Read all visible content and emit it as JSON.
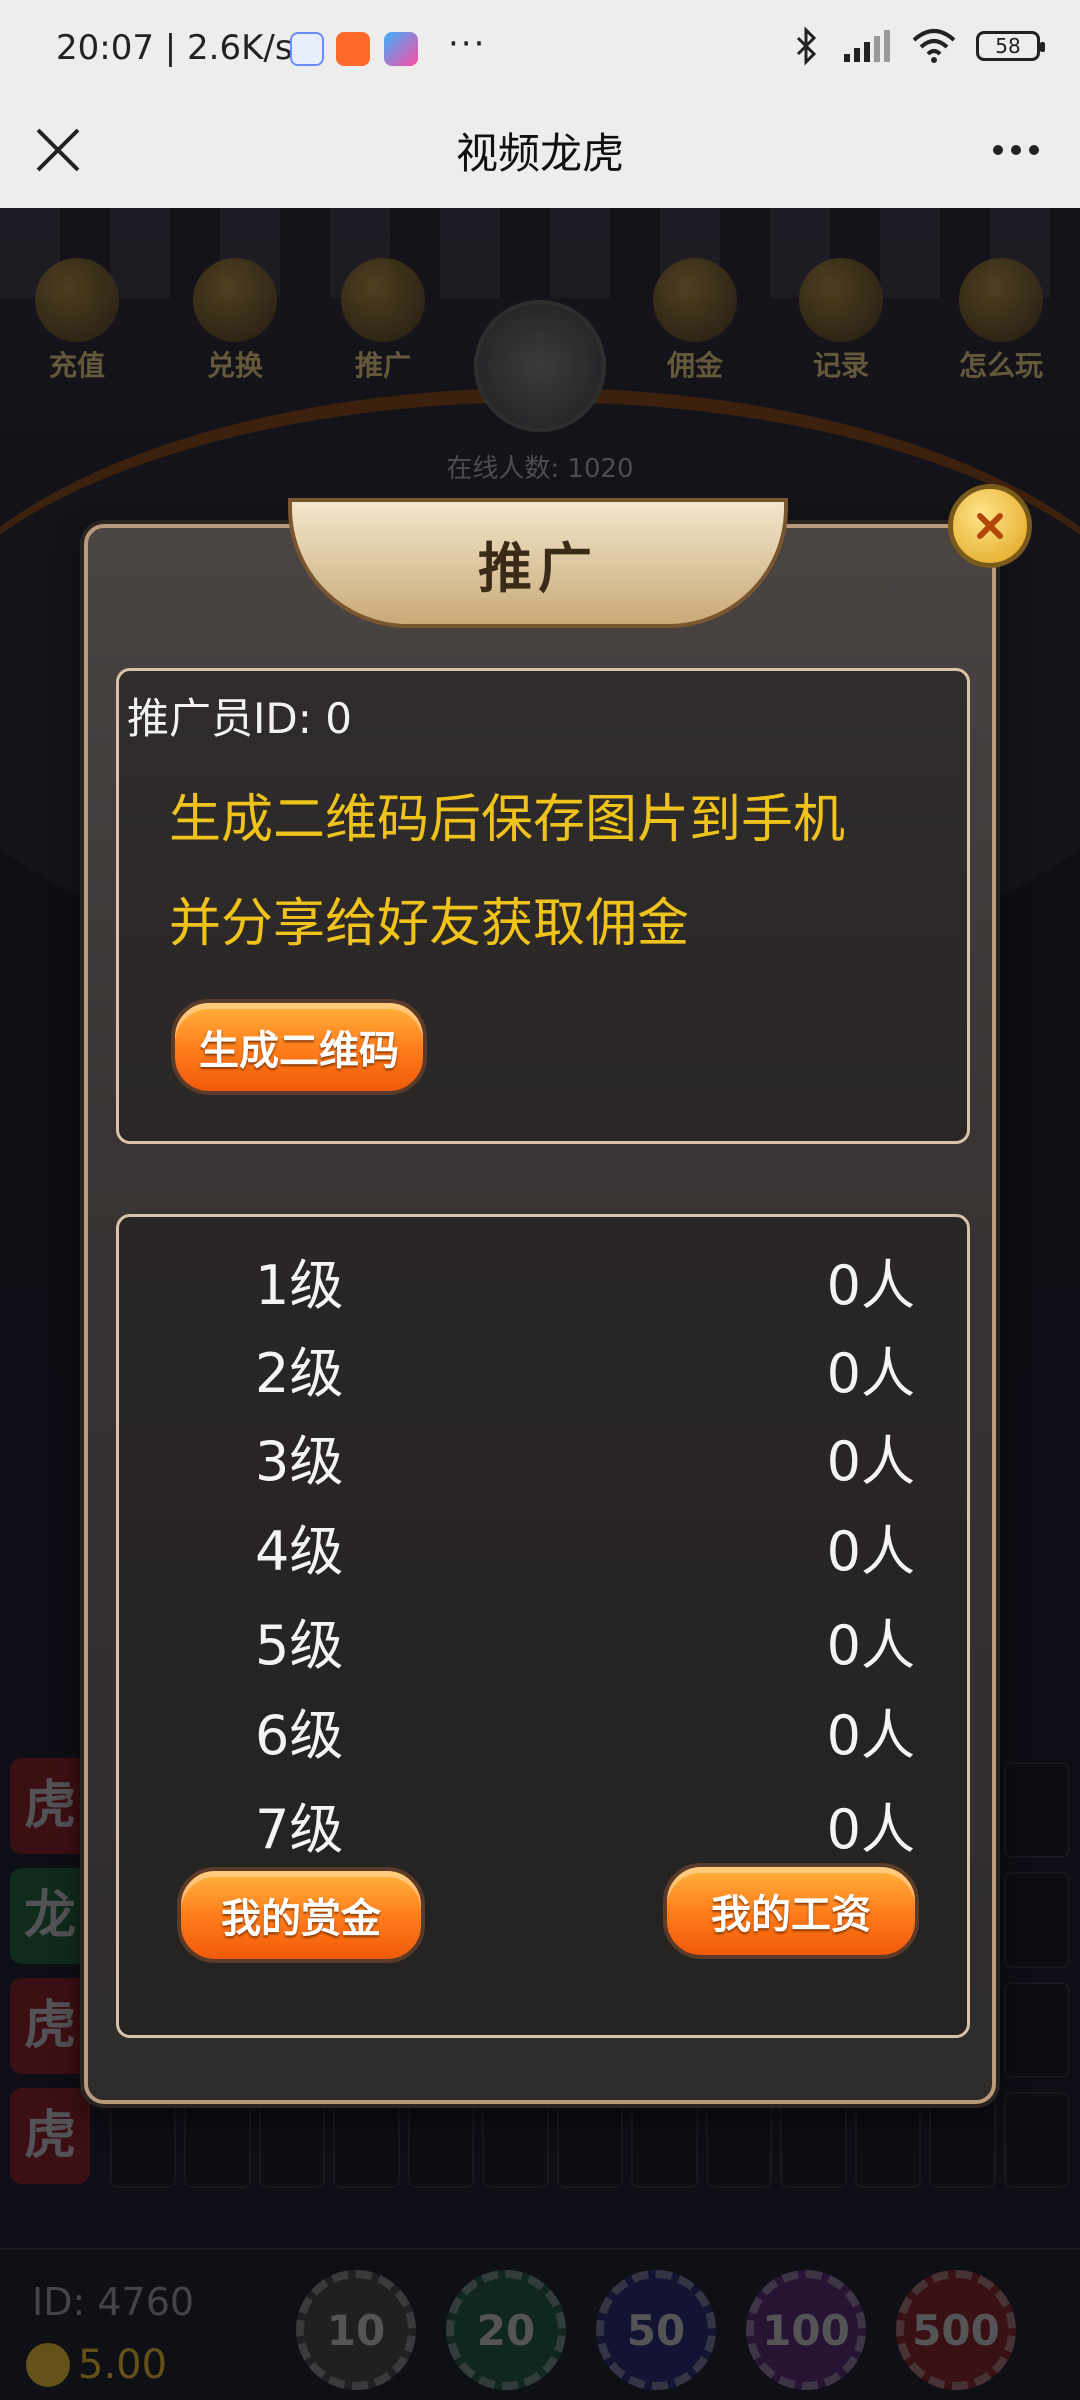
{
  "status_bar": {
    "time": "20:07 | 2.6K/s",
    "more": "···",
    "battery": "58"
  },
  "title_bar": {
    "title": "视频龙虎"
  },
  "game_menu": {
    "items": [
      {
        "label": "充值",
        "icon": "chest-icon"
      },
      {
        "label": "兑换",
        "icon": "gift-icon"
      },
      {
        "label": "推广",
        "icon": "share-icon"
      },
      {
        "label": "佣金",
        "icon": "moneybag-icon"
      },
      {
        "label": "记录",
        "icon": "record-icon"
      },
      {
        "label": "怎么玩",
        "icon": "question-icon"
      }
    ],
    "online": "在线人数: 1020"
  },
  "side_tags": [
    "虎",
    "龙",
    "虎",
    "虎"
  ],
  "bottom_bar": {
    "id": "ID: 4760",
    "coins": "5.00",
    "chips": [
      "10",
      "20",
      "50",
      "100",
      "500"
    ]
  },
  "modal": {
    "title": "推广",
    "promoter_id": "推广员ID: 0",
    "desc_line1": "生成二维码后保存图片到手机",
    "desc_line2": "并分享给好友获取佣金",
    "generate_qr": "生成二维码",
    "levels": [
      {
        "level": "1级",
        "count": "0人"
      },
      {
        "level": "2级",
        "count": "0人"
      },
      {
        "level": "3级",
        "count": "0人"
      },
      {
        "level": "4级",
        "count": "0人"
      },
      {
        "level": "5级",
        "count": "0人"
      },
      {
        "level": "6级",
        "count": "0人"
      },
      {
        "level": "7级",
        "count": "0人"
      }
    ],
    "my_reward": "我的赏金",
    "my_salary": "我的工资"
  },
  "colors": {
    "gold_text": "#f0c21c",
    "button_orange": "#ff7a1a",
    "panel_border": "#d9c3a8"
  }
}
